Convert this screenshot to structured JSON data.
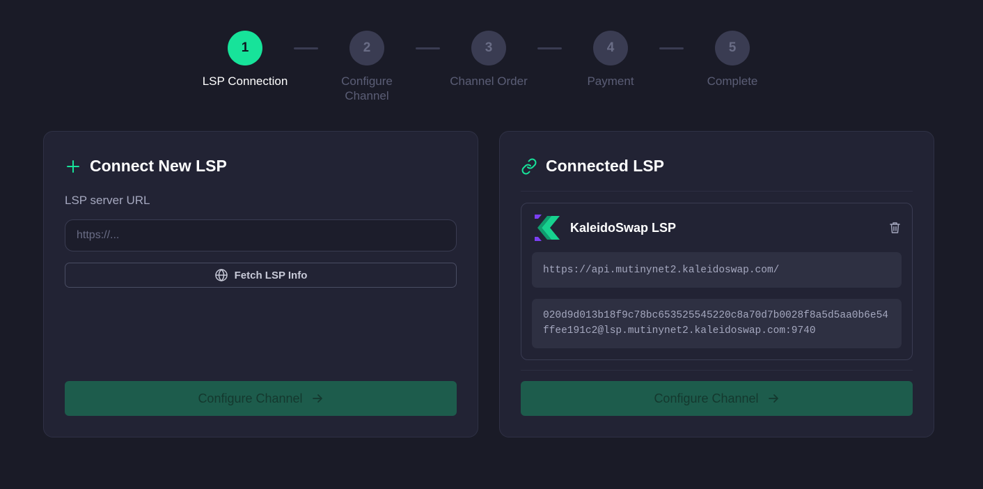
{
  "stepper": {
    "steps": [
      {
        "number": "1",
        "label": "LSP Connection",
        "state": "active"
      },
      {
        "number": "2",
        "label": "Configure Channel",
        "state": "inactive"
      },
      {
        "number": "3",
        "label": "Channel Order",
        "state": "inactive"
      },
      {
        "number": "4",
        "label": "Payment",
        "state": "inactive"
      },
      {
        "number": "5",
        "label": "Complete",
        "state": "inactive"
      }
    ]
  },
  "connect_card": {
    "title": "Connect New LSP",
    "title_icon": "plus-icon",
    "field_label": "LSP server URL",
    "url_value": "",
    "url_placeholder": "https://...",
    "fetch_label": "Fetch LSP Info",
    "fetch_icon": "globe-icon",
    "submit_label": "Configure Channel",
    "submit_icon": "arrow-right-icon"
  },
  "connected_card": {
    "title": "Connected LSP",
    "title_icon": "link-icon",
    "lsp": {
      "name": "KaleidoSwap LSP",
      "logo": "kaleidoswap-logo",
      "url": "https://api.mutinynet2.kaleidoswap.com/",
      "connection": "020d9d013b18f9c78bc653525545220c8a70d7b0028f8a5d5aa0b6e54ffee191c2@lsp.mutinynet2.kaleidoswap.com:9740",
      "delete_icon": "trash-icon"
    },
    "submit_label": "Configure Channel",
    "submit_icon": "arrow-right-icon"
  },
  "colors": {
    "background": "#1a1b27",
    "card": "#222334",
    "accent": "#17e39a",
    "button_disabled": "#1d5c4c",
    "step_inactive": "#3a3c52"
  }
}
